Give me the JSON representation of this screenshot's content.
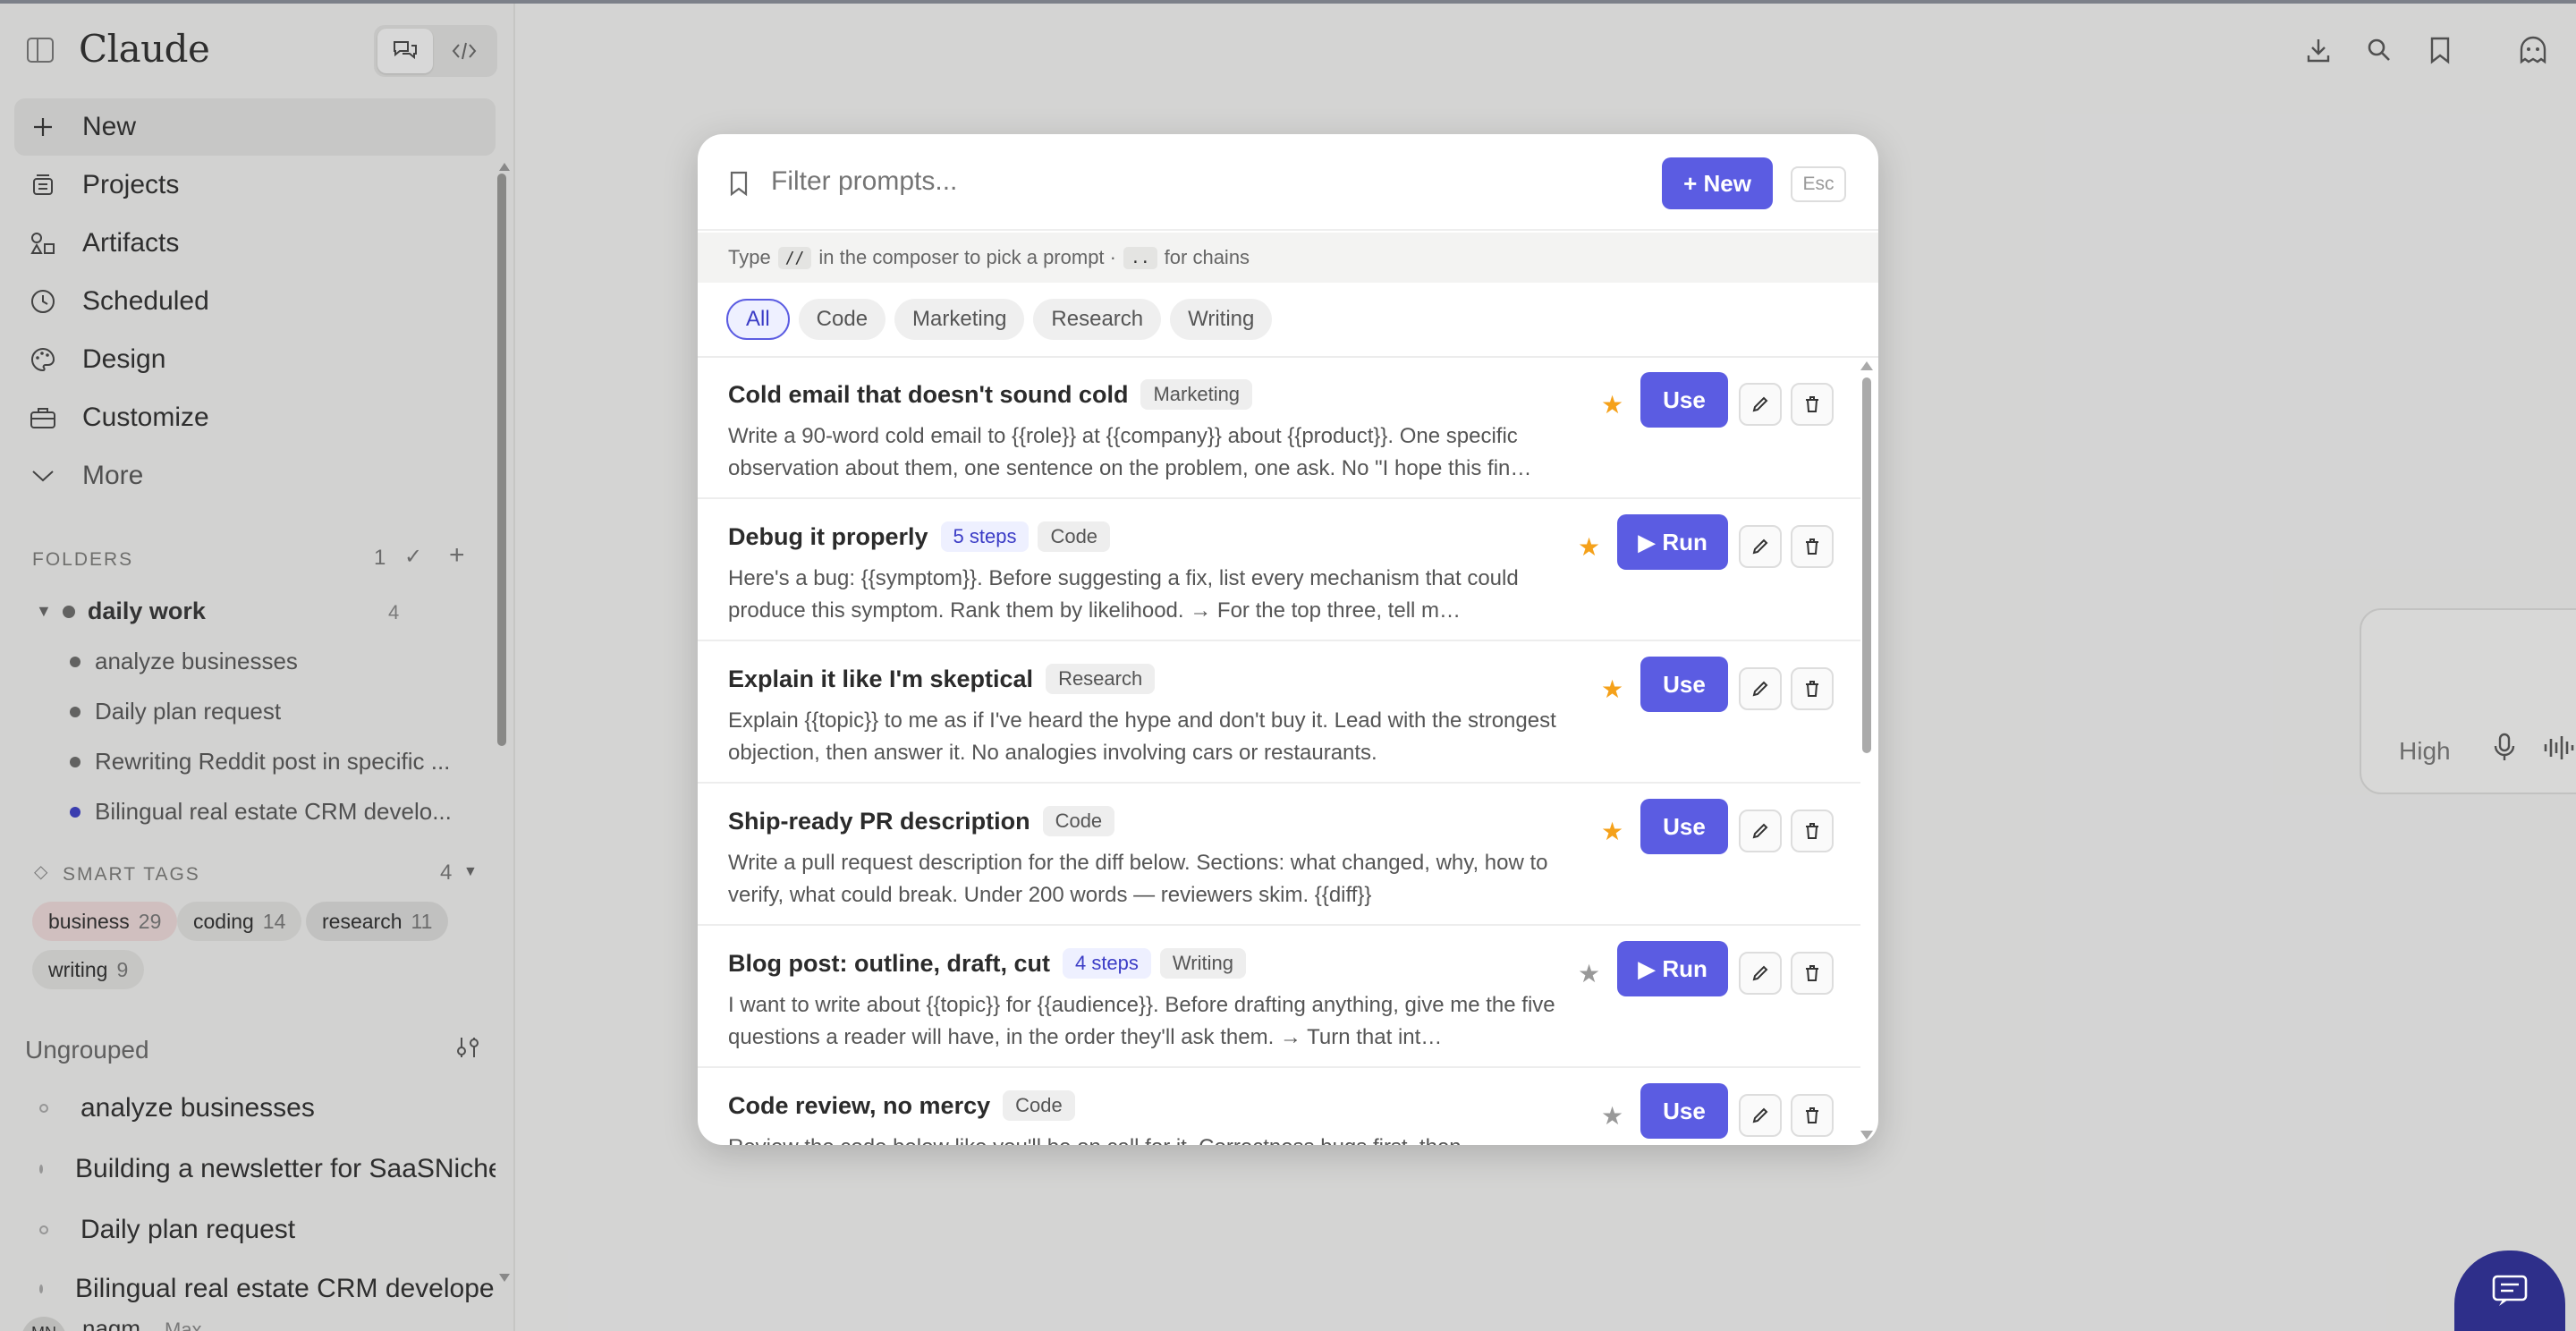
{
  "app": {
    "logo": "Claude"
  },
  "sidebar": {
    "nav": [
      {
        "label": "New",
        "icon": "plus-icon"
      },
      {
        "label": "Projects",
        "icon": "projects-icon"
      },
      {
        "label": "Artifacts",
        "icon": "artifacts-icon"
      },
      {
        "label": "Scheduled",
        "icon": "clock-icon"
      },
      {
        "label": "Design",
        "icon": "palette-icon"
      },
      {
        "label": "Customize",
        "icon": "briefcase-icon"
      },
      {
        "label": "More",
        "icon": "chevron-down-icon"
      }
    ],
    "folders": {
      "title": "FOLDERS",
      "count": "1",
      "folder": {
        "name": "daily work",
        "count": "4"
      },
      "items": [
        "analyze businesses",
        "Daily plan request",
        "Rewriting Reddit post in specific ...",
        "Bilingual real estate CRM develo..."
      ]
    },
    "smart_tags": {
      "title": "SMART TAGS",
      "count": "4",
      "tags": [
        {
          "name": "business",
          "count": "29"
        },
        {
          "name": "coding",
          "count": "14"
        },
        {
          "name": "research",
          "count": "11"
        },
        {
          "name": "writing",
          "count": "9"
        }
      ]
    },
    "ungrouped": {
      "title": "Ungrouped",
      "items": [
        "analyze businesses",
        "Building a newsletter for SaaSNiche",
        "Daily plan request",
        "Bilingual real estate CRM developer"
      ]
    },
    "user": {
      "initials": "MN",
      "name": "nagm",
      "plan": "Max"
    }
  },
  "composer": {
    "effort": "High"
  },
  "modal": {
    "search_placeholder": "Filter prompts...",
    "new_label": "+ New",
    "esc_label": "Esc",
    "hint": {
      "pre": "Type",
      "kbd1": "//",
      "mid": "in the composer to pick a prompt ·",
      "kbd2": "..",
      "post": "for chains"
    },
    "filters": [
      "All",
      "Code",
      "Marketing",
      "Research",
      "Writing"
    ],
    "prompts": [
      {
        "title": "Cold email that doesn't sound cold",
        "steps": "",
        "tag": "Marketing",
        "desc": "Write a 90-word cold email to {{role}} at {{company}} about {{product}}. One specific observation about them, one sentence on the problem, one ask. No \"I hope this fin…",
        "starred": true,
        "action": "Use"
      },
      {
        "title": "Debug it properly",
        "steps": "5 steps",
        "tag": "Code",
        "desc": "Here's a bug: {{symptom}}. Before suggesting a fix, list every mechanism that could produce this symptom. Rank them by likelihood. → For the top three, tell m…",
        "starred": true,
        "action": "▶ Run"
      },
      {
        "title": "Explain it like I'm skeptical",
        "steps": "",
        "tag": "Research",
        "desc": "Explain {{topic}} to me as if I've heard the hype and don't buy it. Lead with the strongest objection, then answer it. No analogies involving cars or restaurants.",
        "starred": true,
        "action": "Use"
      },
      {
        "title": "Ship-ready PR description",
        "steps": "",
        "tag": "Code",
        "desc": "Write a pull request description for the diff below. Sections: what changed, why, how to verify, what could break. Under 200 words — reviewers skim. {{diff}}",
        "starred": true,
        "action": "Use"
      },
      {
        "title": "Blog post: outline, draft, cut",
        "steps": "4 steps",
        "tag": "Writing",
        "desc": "I want to write about {{topic}} for {{audience}}. Before drafting anything, give me the five questions a reader will have, in the order they'll ask them. → Turn that int…",
        "starred": false,
        "action": "▶ Run"
      },
      {
        "title": "Code review, no mercy",
        "steps": "",
        "tag": "Code",
        "desc": "Review the code below like you'll be on call for it. Correctness bugs first, then",
        "starred": false,
        "action": "Use"
      }
    ]
  },
  "colors": {
    "accent": "#5b5ce2",
    "star": "#f5a11a"
  }
}
